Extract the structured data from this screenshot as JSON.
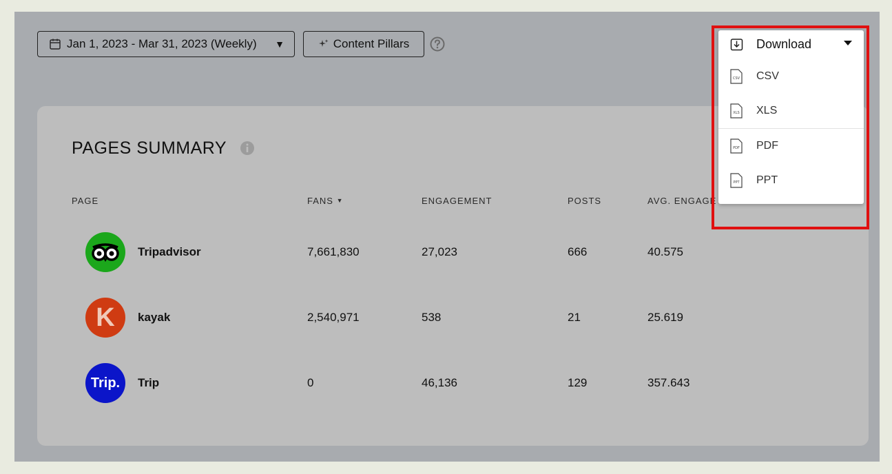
{
  "toolbar": {
    "date_range": "Jan 1, 2023 - Mar 31, 2023 (Weekly)",
    "content_pillars": "Content Pillars"
  },
  "card": {
    "title": "PAGES SUMMARY",
    "columns": {
      "page": "PAGE",
      "fans": "FANS",
      "engagement": "ENGAGEMENT",
      "posts": "POSTS",
      "avg_engagement": "AVG. ENGAGE"
    },
    "rows": [
      {
        "name": "Tripadvisor",
        "fans": "7,661,830",
        "engagement": "27,023",
        "posts": "666",
        "avg": "40.575",
        "color": "#1ba71b"
      },
      {
        "name": "kayak",
        "fans": "2,540,971",
        "engagement": "538",
        "posts": "21",
        "avg": "25.619",
        "color": "#cf3b12",
        "logo_text": "K"
      },
      {
        "name": "Trip",
        "fans": "0",
        "engagement": "46,136",
        "posts": "129",
        "avg": "357.643",
        "color": "#0b15c9",
        "logo_text": "Trip."
      }
    ]
  },
  "download_menu": {
    "label": "Download",
    "items": [
      {
        "label": "CSV",
        "badge": "CSV"
      },
      {
        "label": "XLS",
        "badge": "XLS"
      },
      {
        "label": "PDF",
        "badge": "PDF"
      },
      {
        "label": "PPT",
        "badge": "PPT"
      }
    ]
  },
  "colors": {
    "highlight": "#e01010",
    "background": "#a8abaf",
    "card": "#bdbdbd"
  }
}
